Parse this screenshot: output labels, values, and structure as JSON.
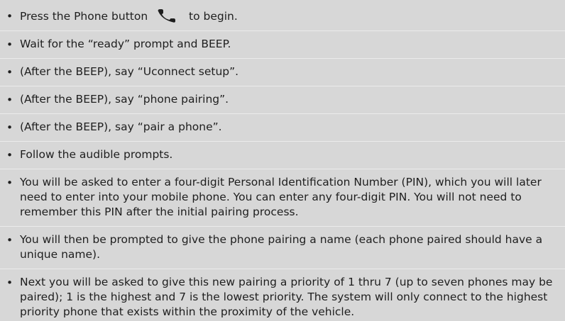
{
  "instructions": [
    {
      "before": "Press the Phone button",
      "icon": "phone-handset-icon",
      "after": "to begin."
    },
    {
      "text": "Wait for the “ready” prompt and BEEP."
    },
    {
      "text": "(After the BEEP), say “Uconnect setup”."
    },
    {
      "text": "(After the BEEP), say “phone pairing”."
    },
    {
      "text": "(After the BEEP), say “pair a phone”."
    },
    {
      "text": "Follow the audible prompts."
    },
    {
      "text": "You will be asked to enter a four-digit Personal Identification Number (PIN), which you will later need to enter into your mobile phone. You can enter any four-digit PIN. You will not need to remember this PIN after the initial pairing process."
    },
    {
      "text": "You will then be prompted to give the phone pairing a name (each phone paired should have a unique name)."
    },
    {
      "text": "Next you will be asked to give this new pairing a priority of 1 thru 7 (up to seven phones may be paired); 1 is the highest and 7 is the lowest priority. The system will only connect to the highest priority phone that exists within the proximity of the vehicle."
    }
  ],
  "bullet": "•",
  "colors": {
    "background": "#d7d7d7",
    "text": "#1e1e1e",
    "separator": "#ebebeb"
  }
}
